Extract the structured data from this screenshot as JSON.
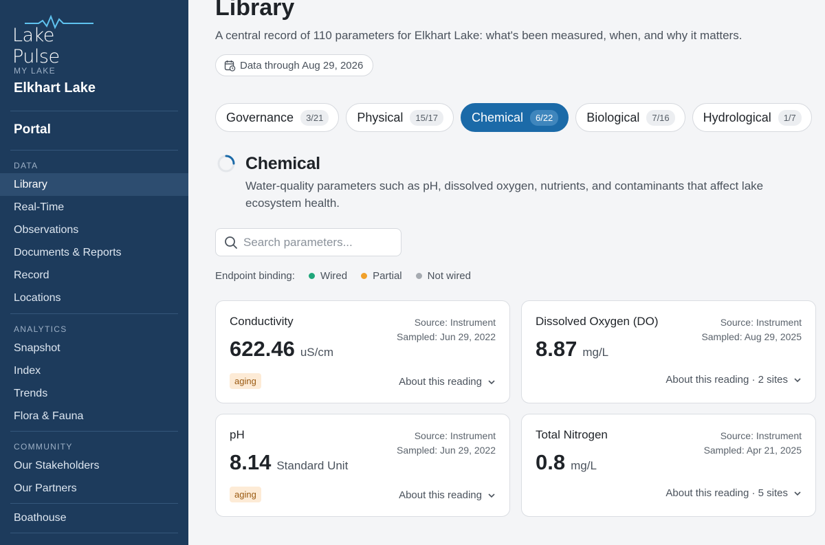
{
  "brand": {
    "logo_text": "Lake Pulse"
  },
  "sidebar": {
    "my_lake_label": "MY LAKE",
    "lake_name": "Elkhart Lake",
    "portal_label": "Portal",
    "data_label": "DATA",
    "data_items": [
      "Library",
      "Real-Time",
      "Observations",
      "Documents & Reports",
      "Record",
      "Locations"
    ],
    "analytics_label": "ANALYTICS",
    "analytics_items": [
      "Snapshot",
      "Index",
      "Trends",
      "Flora & Fauna"
    ],
    "community_label": "COMMUNITY",
    "community_items": [
      "Our Stakeholders",
      "Our Partners"
    ],
    "boathouse_label": "Boathouse"
  },
  "page": {
    "title": "Library",
    "subtitle": "A central record of 110 parameters for Elkhart Lake: what's been measured, when, and why it matters.",
    "data_through": "Data through Aug 29, 2026"
  },
  "tabs": [
    {
      "label": "Governance",
      "count": "3/21",
      "active": false
    },
    {
      "label": "Physical",
      "count": "15/17",
      "active": false
    },
    {
      "label": "Chemical",
      "count": "6/22",
      "active": true
    },
    {
      "label": "Biological",
      "count": "7/16",
      "active": false
    },
    {
      "label": "Hydrological",
      "count": "1/7",
      "active": false
    }
  ],
  "section": {
    "title": "Chemical",
    "description": "Water-quality parameters such as pH, dissolved oxygen, nutrients, and contaminants that affect lake ecosystem health."
  },
  "search": {
    "placeholder": "Search parameters..."
  },
  "legend": {
    "label": "Endpoint binding:",
    "items": [
      {
        "label": "Wired",
        "color": "#1fa67a"
      },
      {
        "label": "Partial",
        "color": "#f0a02a"
      },
      {
        "label": "Not wired",
        "color": "#a6abb1"
      }
    ]
  },
  "cards": [
    {
      "name": "Conductivity",
      "source": "Source: Instrument",
      "sampled": "Sampled: Jun 29, 2022",
      "value": "622.46",
      "unit": "uS/cm",
      "badge": "aging",
      "about": "About this reading"
    },
    {
      "name": "Dissolved Oxygen (DO)",
      "source": "Source: Instrument",
      "sampled": "Sampled: Aug 29, 2025",
      "value": "8.87",
      "unit": "mg/L",
      "badge": "",
      "about": "About this reading · 2 sites"
    },
    {
      "name": "pH",
      "source": "Source: Instrument",
      "sampled": "Sampled: Jun 29, 2022",
      "value": "8.14",
      "unit": "Standard Unit",
      "badge": "aging",
      "about": "About this reading"
    },
    {
      "name": "Total Nitrogen",
      "source": "Source: Instrument",
      "sampled": "Sampled: Apr 21, 2025",
      "value": "0.8",
      "unit": "mg/L",
      "badge": "",
      "about": "About this reading · 5 sites"
    }
  ],
  "colors": {
    "sidebar_bg": "#1d3b5c",
    "accent": "#1b6aa8",
    "badge_bg": "#fdebd6"
  }
}
